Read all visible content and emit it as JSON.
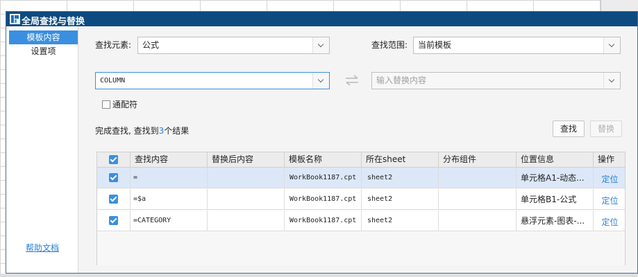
{
  "title": "全局查找与替换",
  "colors": {
    "titlebar": "#0c4a80",
    "accent": "#3a8fe0",
    "link": "#2a7fd4",
    "row_selected": "#dce8f8"
  },
  "sidebar": {
    "items": [
      {
        "label": "模板内容",
        "active": true
      },
      {
        "label": "设置项",
        "active": false
      }
    ],
    "help_link": "帮助文档"
  },
  "search": {
    "element_label": "查找元素:",
    "element_value": "公式",
    "scope_label": "查找范围:",
    "scope_value": "当前模板",
    "find_value": "COLUMN",
    "replace_placeholder": "输入替换内容"
  },
  "wildcard_label": "通配符",
  "status": {
    "prefix": "完成查找, 查找到",
    "count": "3",
    "suffix": "个结果"
  },
  "buttons": {
    "find": "查找",
    "replace": "替换"
  },
  "table": {
    "columns": [
      "查找内容",
      "替换后内容",
      "模板名称",
      "所在sheet",
      "分布组件",
      "位置信息",
      "操作"
    ],
    "rows": [
      {
        "checked": true,
        "content": "=",
        "replaced": "",
        "template": "WorkBook1187.cpt",
        "sheet": "sheet2",
        "component": "",
        "position": "单元格A1-动态...",
        "action": "定位"
      },
      {
        "checked": true,
        "content": "=$a",
        "replaced": "",
        "template": "WorkBook1187.cpt",
        "sheet": "sheet2",
        "component": "",
        "position": "单元格B1-公式",
        "action": "定位"
      },
      {
        "checked": true,
        "content": "=CATEGORY",
        "replaced": "",
        "template": "WorkBook1187.cpt",
        "sheet": "sheet2",
        "component": "",
        "position": "悬浮元素-图表-...",
        "action": "定位"
      }
    ]
  }
}
